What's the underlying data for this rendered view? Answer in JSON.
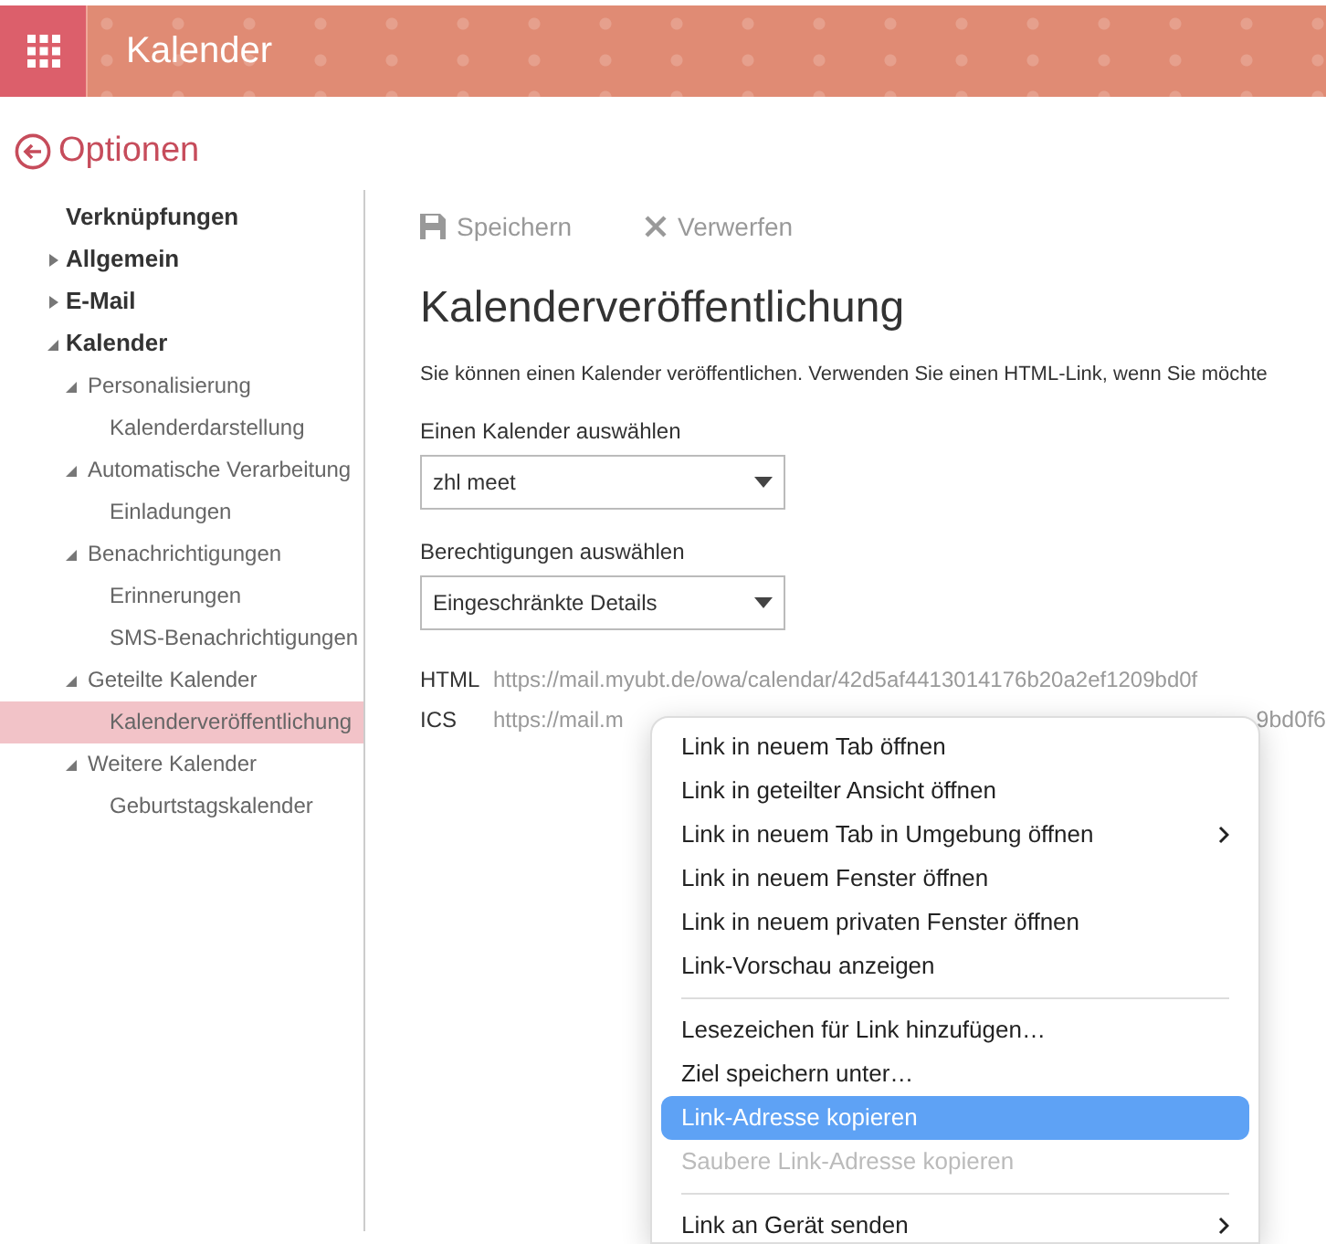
{
  "header": {
    "app_title": "Kalender"
  },
  "back_link": {
    "label": "Optionen"
  },
  "sidebar": {
    "items": [
      {
        "label": "Verknüpfungen",
        "selected": false
      },
      {
        "label": "Allgemein",
        "expanded": false,
        "selected": false
      },
      {
        "label": "E-Mail",
        "expanded": false,
        "selected": false
      },
      {
        "label": "Kalender",
        "expanded": true,
        "selected": false,
        "children": [
          {
            "label": "Personalisierung",
            "expanded": true,
            "selected": false,
            "children": [
              {
                "label": "Kalenderdarstellung",
                "selected": false
              }
            ]
          },
          {
            "label": "Automatische Verarbeitung",
            "expanded": true,
            "selected": false,
            "children": [
              {
                "label": "Einladungen",
                "selected": false
              }
            ]
          },
          {
            "label": "Benachrichtigungen",
            "expanded": true,
            "selected": false,
            "children": [
              {
                "label": "Erinnerungen",
                "selected": false
              },
              {
                "label": "SMS-Benachrichtigungen",
                "selected": false
              }
            ]
          },
          {
            "label": "Geteilte Kalender",
            "expanded": true,
            "selected": false,
            "children": [
              {
                "label": "Kalenderveröffentlichung",
                "selected": true
              }
            ]
          },
          {
            "label": "Weitere Kalender",
            "expanded": true,
            "selected": false,
            "children": [
              {
                "label": "Geburtstagskalender",
                "selected": false
              }
            ]
          }
        ]
      }
    ]
  },
  "toolbar": {
    "buttons": [
      {
        "kind": "save",
        "label": "Speichern",
        "disabled": true
      },
      {
        "kind": "discard",
        "label": "Verwerfen",
        "disabled": true
      }
    ]
  },
  "page_title": "Kalenderveröffentlichung",
  "description": "Sie können einen Kalender veröffentlichen. Verwenden Sie einen HTML-Link, wenn Sie möchte",
  "fields": [
    {
      "label": "Einen Kalender auswählen",
      "value": "zhl meet"
    },
    {
      "label": "Berechtigungen auswählen",
      "value": "Eingeschränkte Details"
    }
  ],
  "links": [
    {
      "label": "HTML",
      "url": "https://mail.myubt.de/owa/calendar/42d5af4413014176b20a2ef1209bd0f"
    },
    {
      "label": "ICS",
      "url": "https://mail.m",
      "url_tail": "9bd0f6"
    }
  ],
  "context_menu": {
    "items": [
      {
        "kind": "item",
        "label": "Link in neuem Tab öffnen",
        "selected": false,
        "disabled": false,
        "submenu": false
      },
      {
        "kind": "item",
        "label": "Link in geteilter Ansicht öffnen",
        "selected": false,
        "disabled": false,
        "submenu": false
      },
      {
        "kind": "item",
        "label": "Link in neuem Tab in Umgebung öffnen",
        "selected": false,
        "disabled": false,
        "submenu": true
      },
      {
        "kind": "item",
        "label": "Link in neuem Fenster öffnen",
        "selected": false,
        "disabled": false,
        "submenu": false
      },
      {
        "kind": "item",
        "label": "Link in neuem privaten Fenster öffnen",
        "selected": false,
        "disabled": false,
        "submenu": false
      },
      {
        "kind": "item",
        "label": "Link-Vorschau anzeigen",
        "selected": false,
        "disabled": false,
        "submenu": false
      },
      {
        "kind": "separator"
      },
      {
        "kind": "item",
        "label": "Lesezeichen für Link hinzufügen…",
        "selected": false,
        "disabled": false,
        "submenu": false
      },
      {
        "kind": "item",
        "label": "Ziel speichern unter…",
        "selected": false,
        "disabled": false,
        "submenu": false
      },
      {
        "kind": "item",
        "label": "Link-Adresse kopieren",
        "selected": true,
        "disabled": false,
        "submenu": false
      },
      {
        "kind": "item",
        "label": "Saubere Link-Adresse kopieren",
        "selected": false,
        "disabled": true,
        "submenu": false
      },
      {
        "kind": "separator"
      },
      {
        "kind": "item",
        "label": "Link an Gerät senden",
        "selected": false,
        "disabled": false,
        "submenu": true
      }
    ]
  }
}
